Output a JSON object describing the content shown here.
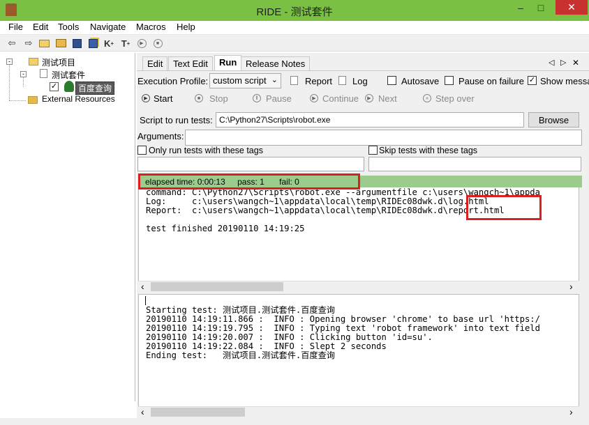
{
  "window": {
    "title": "RIDE - 测试套件",
    "minimize": "–",
    "maximize": "□",
    "close": "✕"
  },
  "menu": [
    "File",
    "Edit",
    "Tools",
    "Navigate",
    "Macros",
    "Help"
  ],
  "toolbar": {
    "k_label": "K",
    "k_sup": "+",
    "t_label": "T",
    "t_sup": "+"
  },
  "tree": {
    "project": "测试项目",
    "suite": "测试套件",
    "testcase": "百度查询",
    "external": "External Resources",
    "check": "✓"
  },
  "tabs": [
    "Edit",
    "Text Edit",
    "Run",
    "Release Notes"
  ],
  "active_tab": "Run",
  "tab_nav": {
    "prev": "◁",
    "next": "▷",
    "close": "✕"
  },
  "run": {
    "exec_profile_label": "Execution Profile:",
    "exec_profile_value": "custom script",
    "report_label": "Report",
    "log_label": "Log",
    "autosave_label": "Autosave",
    "pause_label": "Pause on failure",
    "show_label": "Show message",
    "show_checked": "✓",
    "controls": {
      "start": "Start",
      "stop": "Stop",
      "pause": "Pause",
      "continue": "Continue",
      "next": "Next",
      "step": "Step over"
    },
    "script_label": "Script to run tests:",
    "script_value": "C:\\Python27\\Scripts\\robot.exe",
    "browse": "Browse",
    "arguments_label": "Arguments:",
    "only_tags_label": "Only run tests with these tags",
    "skip_tags_label": "Skip tests with these tags"
  },
  "status": {
    "elapsed": "elapsed time: 0:00:13",
    "pass": "pass: 1",
    "fail": "fail: 0"
  },
  "output_lines": [
    "command: C:\\Python27\\Scripts\\robot.exe --argumentfile c:\\users\\wangch~1\\appda",
    "Log:     c:\\users\\wangch~1\\appdata\\local\\temp\\RIDEc08dwk.d\\log.html",
    "Report:  c:\\users\\wangch~1\\appdata\\local\\temp\\RIDEc08dwk.d\\report.html",
    "",
    "test finished 20190110 14:19:25"
  ],
  "log_lines": [
    "Starting test: 测试项目.测试套件.百度查询",
    "20190110 14:19:11.866 :  INFO : Opening browser 'chrome' to base url 'https:/",
    "20190110 14:19:19.795 :  INFO : Typing text 'robot framework' into text field",
    "20190110 14:19:20.007 :  INFO : Clicking button 'id=su'.",
    "20190110 14:19:22.084 :  INFO : Slept 2 seconds",
    "Ending test:   测试项目.测试套件.百度查询"
  ],
  "scroll": {
    "left": "‹",
    "right": "›"
  },
  "colors": {
    "titlebar": "#7ac143",
    "status": "#9ccc8d",
    "highlight": "#d9201f"
  }
}
